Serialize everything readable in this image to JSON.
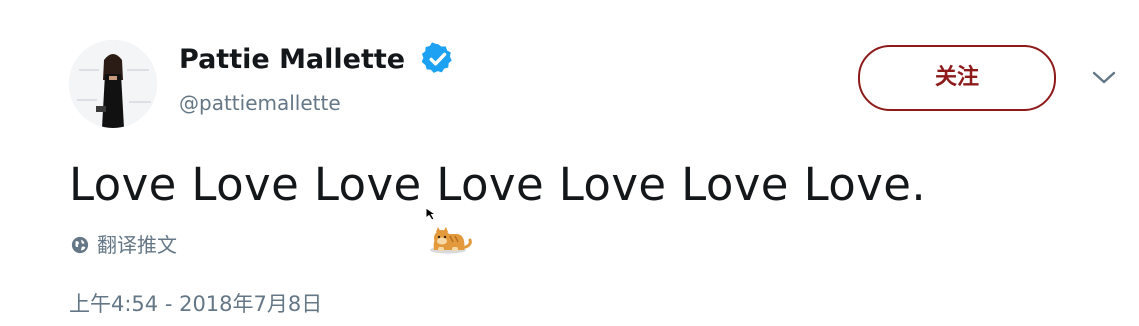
{
  "user": {
    "display_name": "Pattie Mallette",
    "handle": "@pattiemallette",
    "verified": true
  },
  "actions": {
    "follow_label": "关注",
    "accent_color": "#8e1a1a"
  },
  "tweet": {
    "text": "Love Love Love Love Love Love Love.",
    "translate_label": "翻译推文",
    "timestamp": "上午4:54 - 2018年7月8日"
  },
  "icons": {
    "verified": "verified-badge-icon",
    "more": "chevron-down-icon",
    "translate": "globe-icon",
    "pointer": "mouse-cursor-icon",
    "sticker": "cat-sticker-icon"
  },
  "colors": {
    "text_primary": "#14171a",
    "text_secondary": "#657786",
    "verified_blue": "#1da1f2"
  }
}
